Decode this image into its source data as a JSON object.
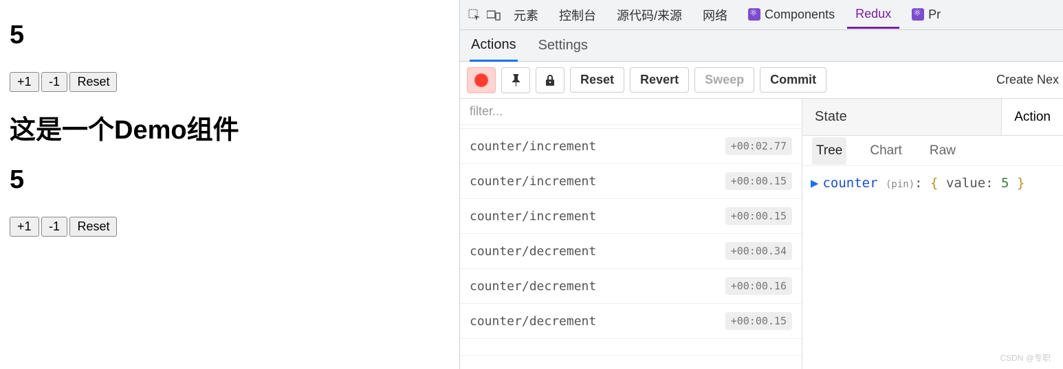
{
  "app": {
    "counter1": "5",
    "counter2": "5",
    "demo_title": "这是一个Demo组件",
    "btn_inc": "+1",
    "btn_dec": "-1",
    "btn_reset": "Reset"
  },
  "devtools": {
    "top_tabs": {
      "elements": "元素",
      "console": "控制台",
      "sources": "源代码/来源",
      "network": "网络",
      "components": "Components",
      "redux": "Redux",
      "profiler": "Pr"
    },
    "sub_tabs": {
      "actions": "Actions",
      "settings": "Settings"
    },
    "toolbar": {
      "reset": "Reset",
      "revert": "Revert",
      "sweep": "Sweep",
      "commit": "Commit",
      "create_new": "Create Nex"
    },
    "filter_placeholder": "filter...",
    "actions_list": [
      {
        "name": "counter/increment",
        "ts": "+00:02.77"
      },
      {
        "name": "counter/increment",
        "ts": "+00:00.15"
      },
      {
        "name": "counter/increment",
        "ts": "+00:00.15"
      },
      {
        "name": "counter/decrement",
        "ts": "+00:00.34"
      },
      {
        "name": "counter/decrement",
        "ts": "+00:00.16"
      },
      {
        "name": "counter/decrement",
        "ts": "+00:00.15"
      }
    ],
    "state_panel": {
      "label": "State",
      "action_btn": "Action",
      "view_tabs": {
        "tree": "Tree",
        "chart": "Chart",
        "raw": "Raw"
      },
      "tree": {
        "key": "counter",
        "pin": "(pin)",
        "prop": "value",
        "val": "5"
      }
    }
  },
  "watermark": "CSDN @专职"
}
